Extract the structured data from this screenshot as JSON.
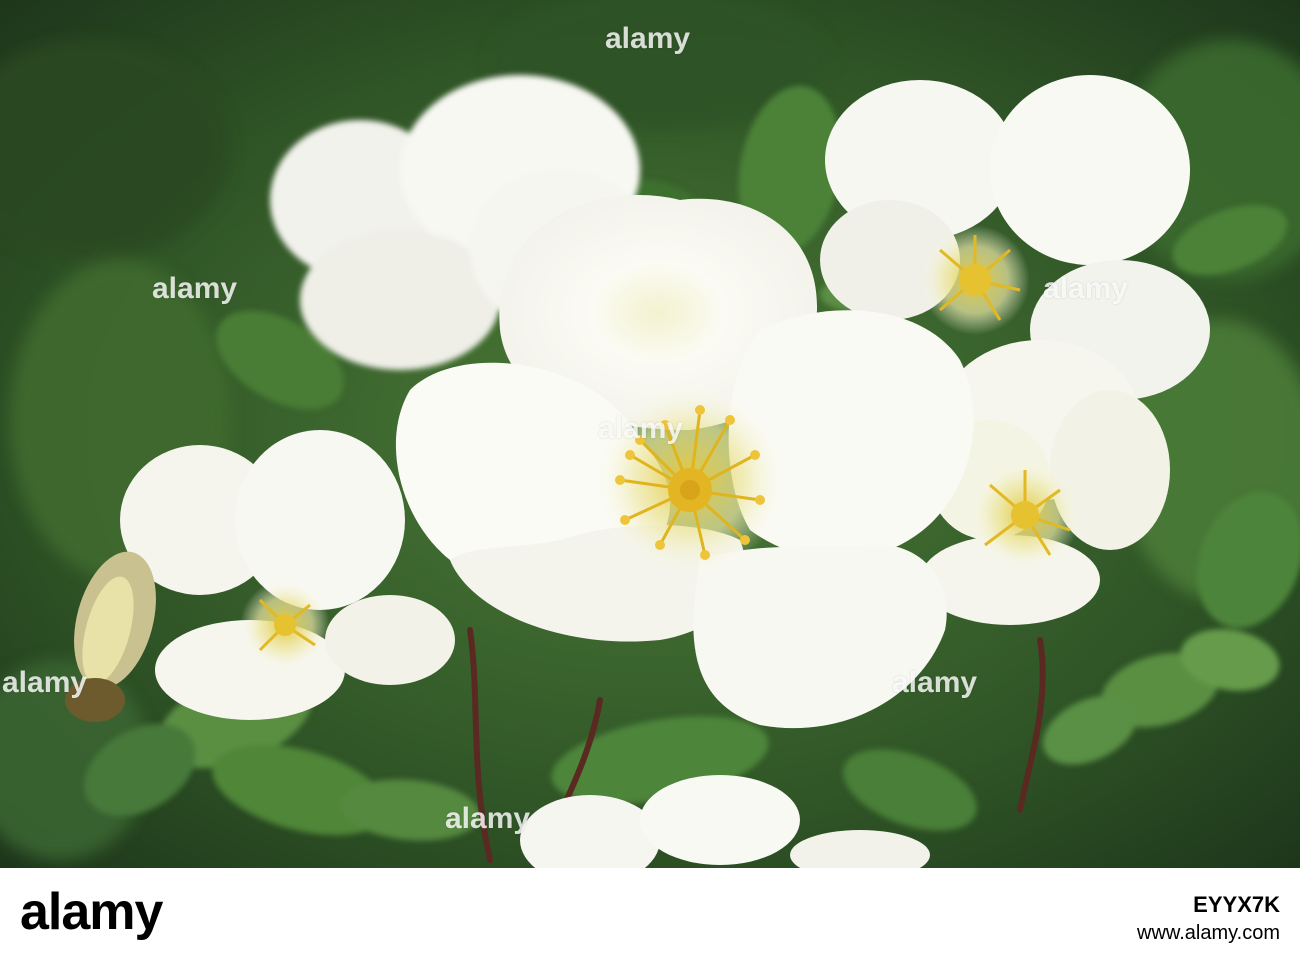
{
  "photo": {
    "subject": "white wild roses with yellow stamens among green leaves",
    "colors": {
      "background_dark": "#1f3a1c",
      "background_mid": "#3d6a2e",
      "leaf": "#4a7d36",
      "petal": "#fbfbf6",
      "petal_shadow": "#e6e6d8",
      "stamen": "#e9c22a",
      "stem": "#5a2a22"
    }
  },
  "watermark": {
    "text": "alamy"
  },
  "footer": {
    "logo": "alamy",
    "image_id": "EYYX7K",
    "url": "www.alamy.com"
  }
}
